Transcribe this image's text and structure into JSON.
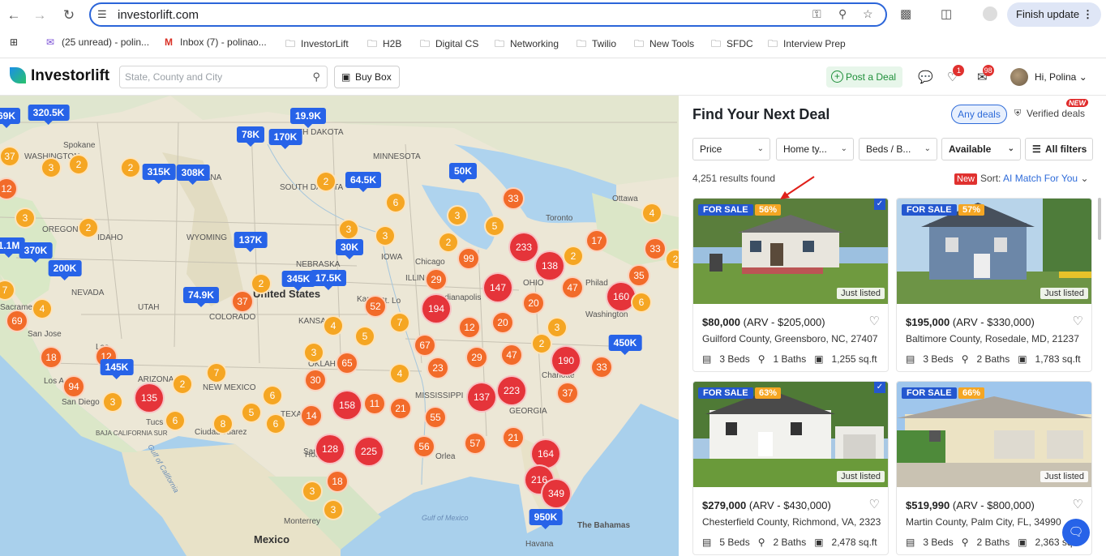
{
  "browser": {
    "url": "investorlift.com",
    "finish_update": "Finish update",
    "bookmarks": [
      {
        "label": "(25 unread) - polin...",
        "icon": "mail-icon"
      },
      {
        "label": "Inbox (7) - polinao...",
        "icon": "gmail-icon"
      },
      {
        "label": "InvestorLift",
        "icon": "folder-icon"
      },
      {
        "label": "H2B",
        "icon": "folder-icon"
      },
      {
        "label": "Digital CS",
        "icon": "folder-icon"
      },
      {
        "label": "Networking",
        "icon": "folder-icon"
      },
      {
        "label": "Twilio",
        "icon": "folder-icon"
      },
      {
        "label": "New Tools",
        "icon": "folder-icon"
      },
      {
        "label": "SFDC",
        "icon": "folder-icon"
      },
      {
        "label": "Interview Prep",
        "icon": "folder-icon"
      }
    ]
  },
  "header": {
    "logo": "Investorlift",
    "search_placeholder": "State, County and City",
    "buy_box": "Buy Box",
    "post_deal": "Post a Deal",
    "likes_badge": "1",
    "mail_badge": "98",
    "greeting": "Hi, Polina"
  },
  "map": {
    "labels": [
      "Spokane",
      "WASHINGTON",
      "OREGON",
      "IDAHO",
      "MONTANA",
      "NORTH DAKOTA",
      "SOUTH DAKOTA",
      "MINNESOTA",
      "WYOMING",
      "NEBRASKA",
      "NEVADA",
      "San Jose",
      "Sacrame",
      "Los A",
      "San Diego",
      "Las",
      "ARIZONA",
      "Tucs",
      "UTAH",
      "COLORADO",
      "KANSAS",
      "NEW MEXICO",
      "Ciudad Juarez",
      "TEXAS",
      "San",
      "OKLAHOMA",
      "IOWA",
      "St. Lo",
      "Kan",
      "ILLINOIS",
      "Indianapolis",
      "OHIO",
      "Philad",
      "Washington",
      "Toronto",
      "Ottawa",
      "Charlotte",
      "GEORGIA",
      "MISSISSIPPI",
      "Orlea",
      "Houst",
      "Monterrey",
      "Gulf of California",
      "Gulf of Mexico",
      "The Bahamas",
      "Havana",
      "Mexico",
      "BAJA CALIFORNIA SUR",
      "Chicago",
      "United States"
    ],
    "country_label": "United States",
    "country_mexico": "Mexico"
  },
  "clusters": [
    {
      "v": "37",
      "t": "o"
    },
    {
      "v": "3",
      "t": "o"
    },
    {
      "v": "2",
      "t": "o"
    },
    {
      "v": "12",
      "t": "m"
    },
    {
      "v": "3",
      "t": "o"
    },
    {
      "v": "2",
      "t": "o"
    },
    {
      "v": "2",
      "t": "o"
    },
    {
      "v": "7",
      "t": "o"
    },
    {
      "v": "4",
      "t": "o"
    },
    {
      "v": "69",
      "t": "m"
    },
    {
      "v": "18",
      "t": "m"
    },
    {
      "v": "94",
      "t": "m"
    },
    {
      "v": "12",
      "t": "m"
    },
    {
      "v": "135",
      "t": "r"
    },
    {
      "v": "3",
      "t": "o"
    },
    {
      "v": "2",
      "t": "o"
    },
    {
      "v": "7",
      "t": "o"
    },
    {
      "v": "6",
      "t": "o"
    },
    {
      "v": "6",
      "t": "o"
    },
    {
      "v": "5",
      "t": "o"
    },
    {
      "v": "8",
      "t": "o"
    },
    {
      "v": "6",
      "t": "o"
    },
    {
      "v": "2",
      "t": "o"
    },
    {
      "v": "37",
      "t": "m"
    },
    {
      "v": "2",
      "t": "o"
    },
    {
      "v": "6",
      "t": "o"
    },
    {
      "v": "3",
      "t": "o"
    },
    {
      "v": "3",
      "t": "o"
    },
    {
      "v": "52",
      "t": "m"
    },
    {
      "v": "4",
      "t": "o"
    },
    {
      "v": "5",
      "t": "o"
    },
    {
      "v": "7",
      "t": "o"
    },
    {
      "v": "3",
      "t": "o"
    },
    {
      "v": "65",
      "t": "m"
    },
    {
      "v": "30",
      "t": "m"
    },
    {
      "v": "14",
      "t": "m"
    },
    {
      "v": "158",
      "t": "r"
    },
    {
      "v": "11",
      "t": "m"
    },
    {
      "v": "21",
      "t": "m"
    },
    {
      "v": "55",
      "t": "m"
    },
    {
      "v": "4",
      "t": "o"
    },
    {
      "v": "67",
      "t": "m"
    },
    {
      "v": "23",
      "t": "m"
    },
    {
      "v": "128",
      "t": "r"
    },
    {
      "v": "225",
      "t": "r"
    },
    {
      "v": "56",
      "t": "m"
    },
    {
      "v": "3",
      "t": "o"
    },
    {
      "v": "18",
      "t": "m"
    },
    {
      "v": "3",
      "t": "o"
    },
    {
      "v": "29",
      "t": "m"
    },
    {
      "v": "194",
      "t": "r"
    },
    {
      "v": "99",
      "t": "m"
    },
    {
      "v": "12",
      "t": "m"
    },
    {
      "v": "20",
      "t": "m"
    },
    {
      "v": "29",
      "t": "m"
    },
    {
      "v": "47",
      "t": "m"
    },
    {
      "v": "137",
      "t": "r"
    },
    {
      "v": "223",
      "t": "r"
    },
    {
      "v": "57",
      "t": "m"
    },
    {
      "v": "21",
      "t": "m"
    },
    {
      "v": "2",
      "t": "o"
    },
    {
      "v": "3",
      "t": "o"
    },
    {
      "v": "5",
      "t": "o"
    },
    {
      "v": "233",
      "t": "r"
    },
    {
      "v": "138",
      "t": "r"
    },
    {
      "v": "147",
      "t": "r"
    },
    {
      "v": "20",
      "t": "m"
    },
    {
      "v": "3",
      "t": "o"
    },
    {
      "v": "2",
      "t": "o"
    },
    {
      "v": "190",
      "t": "r"
    },
    {
      "v": "37",
      "t": "m"
    },
    {
      "v": "33",
      "t": "m"
    },
    {
      "v": "164",
      "t": "r"
    },
    {
      "v": "216",
      "t": "r"
    },
    {
      "v": "349",
      "t": "r"
    },
    {
      "v": "17",
      "t": "m"
    },
    {
      "v": "2",
      "t": "o"
    },
    {
      "v": "47",
      "t": "m"
    },
    {
      "v": "160",
      "t": "r"
    },
    {
      "v": "35",
      "t": "m"
    },
    {
      "v": "6",
      "t": "o"
    },
    {
      "v": "33",
      "t": "m"
    },
    {
      "v": "4",
      "t": "o"
    },
    {
      "v": "33",
      "t": "m"
    },
    {
      "v": "2",
      "t": "o"
    }
  ],
  "prices": [
    "69K",
    "320.5K",
    "19.9K",
    "78K",
    "170K",
    "315K",
    "308K",
    "64.5K",
    "50K",
    "1.1M",
    "370K",
    "200K",
    "137K",
    "30K",
    "345K",
    "17.5K",
    "74.9K",
    "145K",
    "450K",
    "950K"
  ],
  "panel": {
    "title": "Find Your Next Deal",
    "any_deals": "Any deals",
    "verified_deals": "Verified deals",
    "new_tag": "NEW",
    "filters": [
      "Price",
      "Home ty...",
      "Beds / B...",
      "Available",
      "All filters"
    ],
    "results": "4,251 results found",
    "sort_new": "New",
    "sort_label": "Sort:",
    "sort_value": "AI Match For You",
    "listings": [
      {
        "status": "FOR SALE",
        "pct": "56%",
        "verified": true,
        "tag": "Just listed",
        "price": "$80,000",
        "arv": "(ARV - $205,000)",
        "location": "Guilford County, Greensboro, NC, 27407",
        "beds": "3 Beds",
        "baths": "1 Baths",
        "sqft": "1,255 sq.ft"
      },
      {
        "status": "FOR SALE",
        "pct": "57%",
        "verified": false,
        "tag": "Just listed",
        "price": "$195,000",
        "arv": "(ARV - $330,000)",
        "location": "Baltimore County, Rosedale, MD, 21237",
        "beds": "3 Beds",
        "baths": "2 Baths",
        "sqft": "1,783 sq.ft"
      },
      {
        "status": "FOR SALE",
        "pct": "63%",
        "verified": true,
        "tag": "Just listed",
        "price": "$279,000",
        "arv": "(ARV - $430,000)",
        "location": "Chesterfield County, Richmond, VA, 2323",
        "beds": "5 Beds",
        "baths": "2 Baths",
        "sqft": "2,478 sq.ft"
      },
      {
        "status": "FOR SALE",
        "pct": "66%",
        "verified": false,
        "tag": "Just listed",
        "price": "$519,990",
        "arv": "(ARV - $800,000)",
        "location": "Martin County, Palm City, FL, 34990",
        "beds": "3 Beds",
        "baths": "2 Baths",
        "sqft": "2,363 sq.ft"
      }
    ]
  }
}
